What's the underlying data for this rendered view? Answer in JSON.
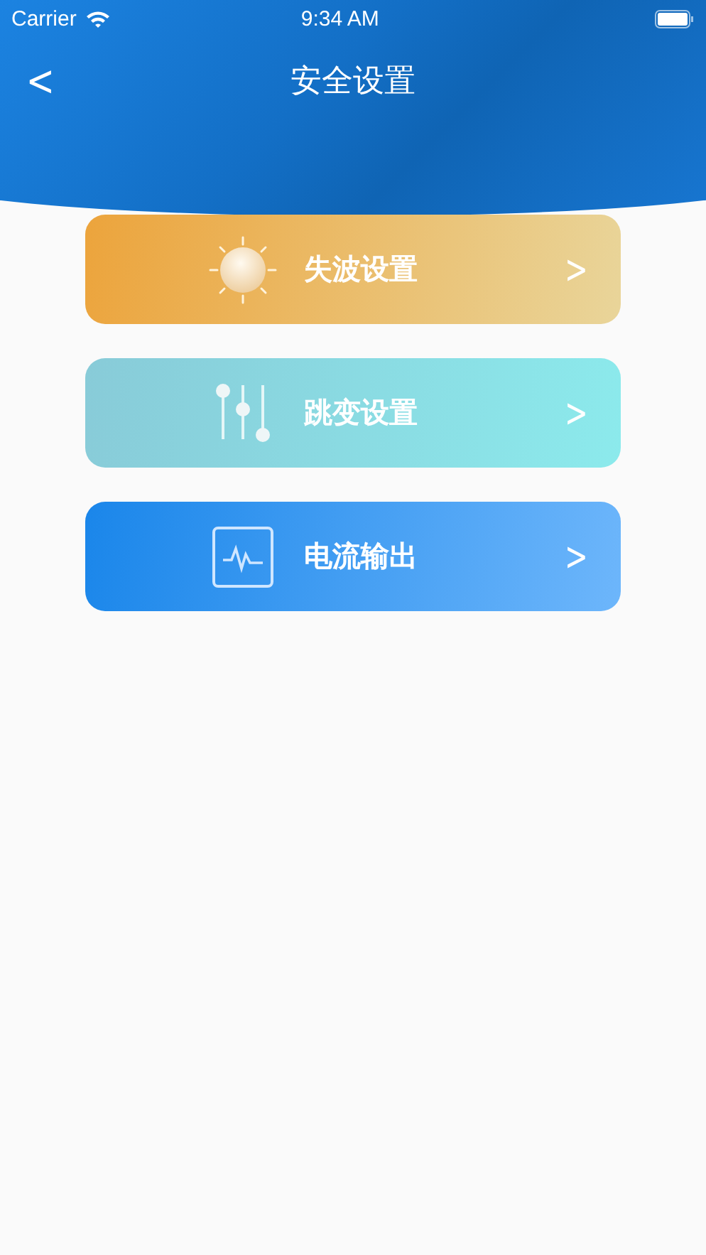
{
  "status_bar": {
    "carrier": "Carrier",
    "time": "9:34 AM"
  },
  "nav": {
    "back": "<",
    "title": "安全设置"
  },
  "menu": [
    {
      "kind": "sun",
      "label": "失波设置",
      "chevron": ">"
    },
    {
      "kind": "sliders",
      "label": "跳变设置",
      "chevron": ">"
    },
    {
      "kind": "pulse",
      "label": "电流输出",
      "chevron": ">"
    }
  ]
}
